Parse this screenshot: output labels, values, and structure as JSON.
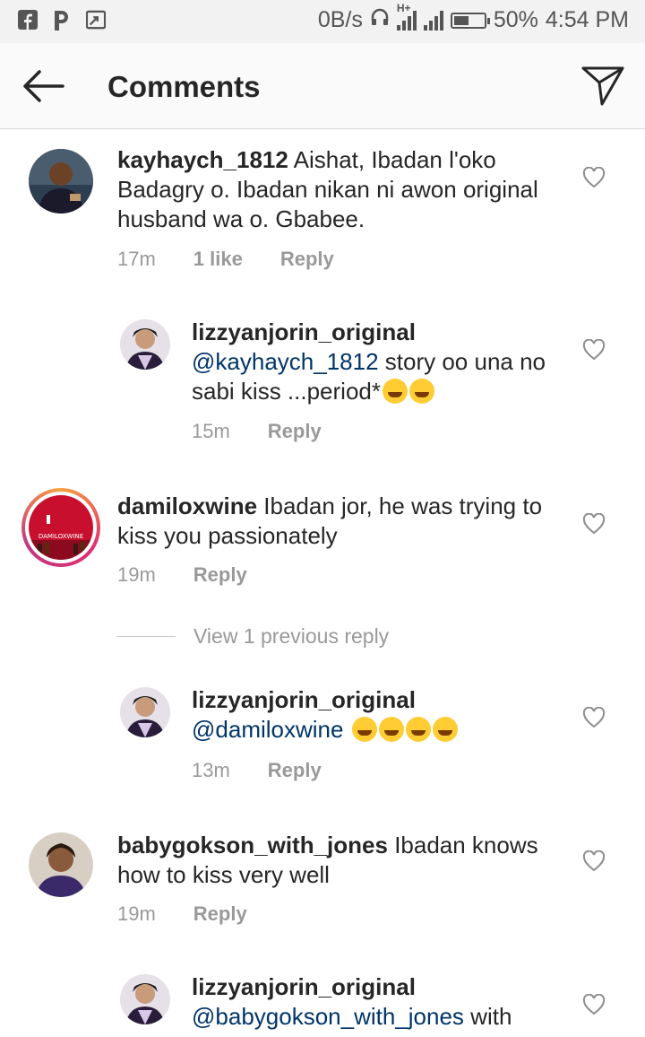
{
  "statusbar": {
    "left_icons": [
      "facebook-icon",
      "pinterest-icon",
      "screenshot-icon"
    ],
    "net_speed": "0B/s",
    "network": "H+",
    "battery_percent": "50%",
    "battery_level": 0.5,
    "time": "4:54 PM"
  },
  "header": {
    "title": "Comments"
  },
  "comments": [
    {
      "username": "kayhaych_1812",
      "text": "Aishat, Ibadan l'oko Badagry o. Ibadan nikan ni awon original husband wa o. Gbabee.",
      "time": "17m",
      "likes": "1 like",
      "reply": "Reply"
    },
    {
      "username": "lizzyanjorin_original",
      "mention": "@kayhaych_1812",
      "text": "story oo una no sabi kiss ...period*",
      "time": "15m",
      "reply": "Reply"
    },
    {
      "username": "damiloxwine",
      "text": "Ibadan jor, he was trying to kiss you passionately",
      "time": "19m",
      "reply": "Reply",
      "avatar_label": "DAMILOXWINE"
    },
    {
      "view_previous": "View 1 previous reply"
    },
    {
      "username": "lizzyanjorin_original",
      "mention": "@damiloxwine",
      "time": "13m",
      "reply": "Reply"
    },
    {
      "username": "babygokson_with_jones",
      "text": "Ibadan knows how to kiss very well",
      "time": "19m",
      "reply": "Reply"
    },
    {
      "username": "lizzyanjorin_original",
      "mention": "@babygokson_with_jones",
      "text": "with"
    }
  ],
  "colors": {
    "mention": "#003569",
    "meta": "#999999",
    "text": "#262626"
  }
}
